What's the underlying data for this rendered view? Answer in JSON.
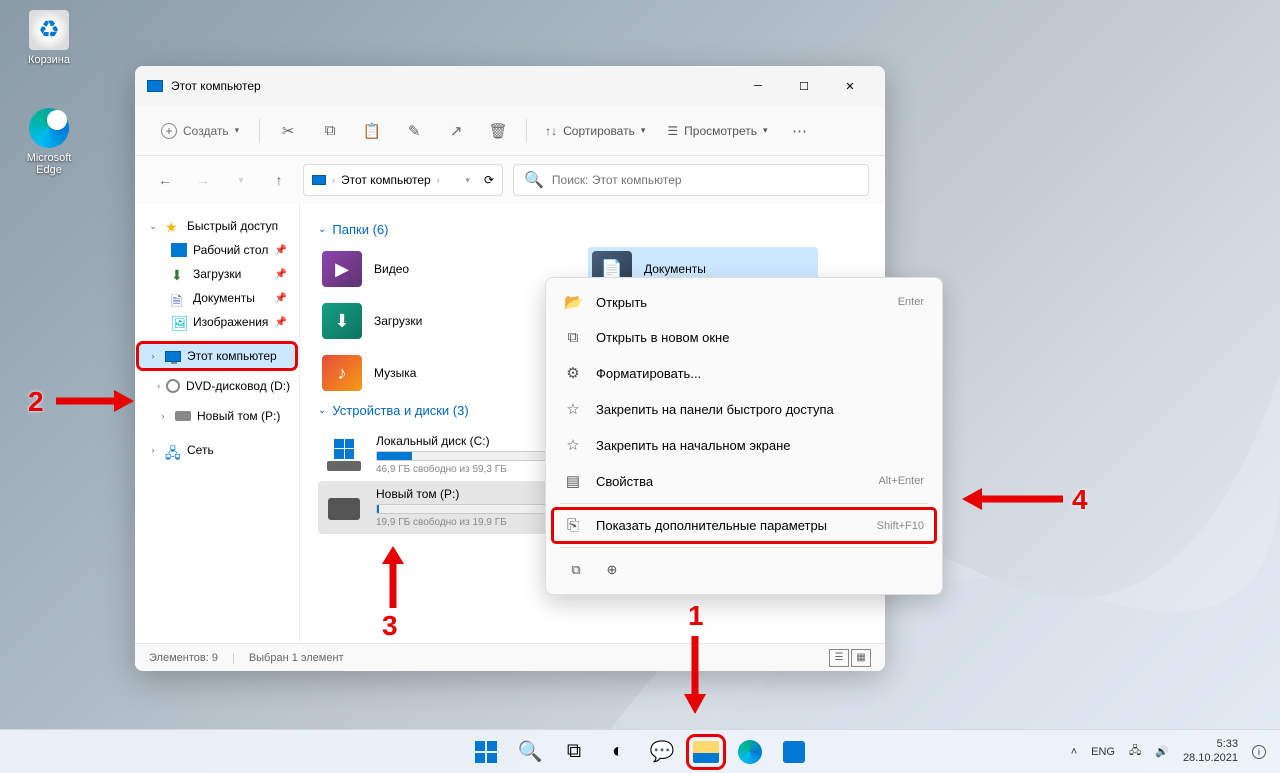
{
  "desktop": {
    "recycle": "Корзина",
    "edge": "Microsoft\nEdge"
  },
  "window": {
    "title": "Этот компьютер",
    "toolbar": {
      "create": "Создать",
      "sort": "Сортировать",
      "view": "Просмотреть"
    },
    "breadcrumb": "Этот компьютер",
    "search_placeholder": "Поиск: Этот компьютер",
    "sidebar": {
      "quick_access": "Быстрый доступ",
      "desktop": "Рабочий стол",
      "downloads": "Загрузки",
      "documents": "Документы",
      "pictures": "Изображения",
      "this_pc": "Этот компьютер",
      "dvd": "DVD-дисковод (D:)",
      "volume": "Новый том (P:)",
      "network": "Сеть"
    },
    "main": {
      "folders_header": "Папки (6)",
      "video": "Видео",
      "documents": "Документы",
      "downloads": "Загрузки",
      "music": "Музыка",
      "drives_header": "Устройства и диски (3)",
      "drive_c": {
        "name": "Локальный диск (C:)",
        "free": "46,9 ГБ свободно из 59,3 ГБ",
        "pct": 21
      },
      "drive_p": {
        "name": "Новый том (P:)",
        "free": "19,9 ГБ свободно из 19,9 ГБ",
        "pct": 0
      }
    },
    "status": {
      "count": "Элементов: 9",
      "selected": "Выбран 1 элемент"
    }
  },
  "context_menu": {
    "open": "Открыть",
    "open_short": "Enter",
    "open_new": "Открыть в новом окне",
    "format": "Форматировать...",
    "pin_qa": "Закрепить на панели быстрого доступа",
    "pin_start": "Закрепить на начальном экране",
    "props": "Свойства",
    "props_short": "Alt+Enter",
    "more": "Показать дополнительные параметры",
    "more_short": "Shift+F10"
  },
  "callouts": {
    "n1": "1",
    "n2": "2",
    "n3": "3",
    "n4": "4"
  },
  "taskbar": {
    "lang": "ENG",
    "time": "5:33",
    "date": "28.10.2021"
  }
}
